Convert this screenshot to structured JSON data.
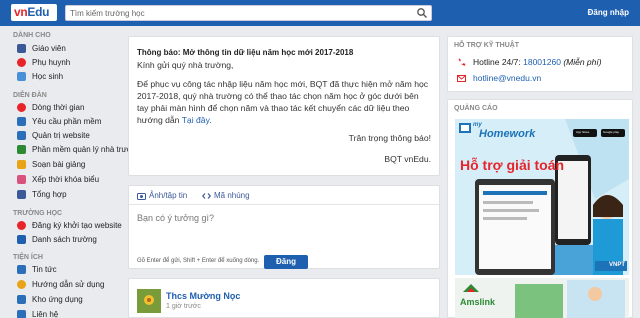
{
  "header": {
    "logo_prefix": "vn",
    "logo_suffix": "Edu",
    "search_placeholder": "Tìm kiếm trường học",
    "login_label": "Đăng nhập"
  },
  "sidebar": {
    "sections": [
      {
        "title": "DÀNH CHO",
        "items": [
          {
            "label": "Giáo viên",
            "icon": "teacher-icon",
            "color": "#3b5998"
          },
          {
            "label": "Phụ huynh",
            "icon": "parent-icon",
            "color": "#e8242b"
          },
          {
            "label": "Học sinh",
            "icon": "student-icon",
            "color": "#4a90d9"
          }
        ]
      },
      {
        "title": "DIỄN ĐÀN",
        "items": [
          {
            "label": "Dòng thời gian",
            "icon": "timeline-icon",
            "color": "#e8242b"
          },
          {
            "label": "Yêu cầu phần mềm",
            "icon": "software-request-icon",
            "color": "#2a6fb8"
          },
          {
            "label": "Quản trị website",
            "icon": "website-admin-icon",
            "color": "#2a6fb8"
          },
          {
            "label": "Phần mềm quản lý nhà trường",
            "icon": "school-software-icon",
            "color": "#2d8a34"
          },
          {
            "label": "Soạn bài giảng",
            "icon": "lesson-icon",
            "color": "#e8a317"
          },
          {
            "label": "Xếp thời khóa biểu",
            "icon": "schedule-icon",
            "color": "#d9527c"
          },
          {
            "label": "Tổng hợp",
            "icon": "summary-icon",
            "color": "#3b5998"
          }
        ]
      },
      {
        "title": "TRƯỜNG HỌC",
        "items": [
          {
            "label": "Đăng ký khởi tạo website",
            "icon": "register-icon",
            "color": "#e8242b"
          },
          {
            "label": "Danh sách trường",
            "icon": "school-list-icon",
            "color": "#1f5fb0"
          }
        ]
      },
      {
        "title": "TIỆN ÍCH",
        "items": [
          {
            "label": "Tin tức",
            "icon": "news-icon",
            "color": "#2a6fb8"
          },
          {
            "label": "Hướng dẫn sử dụng",
            "icon": "guide-icon",
            "color": "#e8a317"
          },
          {
            "label": "Kho ứng dụng",
            "icon": "app-store-icon",
            "color": "#2a6fb8"
          },
          {
            "label": "Liên hệ",
            "icon": "contact-icon",
            "color": "#2a6fb8"
          }
        ]
      }
    ]
  },
  "notice": {
    "title": "Thông báo: Mở thông tin dữ liệu năm học mới 2017-2018",
    "greeting": "Kính gửi quý nhà trường,",
    "body_line1": "Để phục vụ công tác nhập liệu năm học mới, BQT đã thực hiện mở năm học",
    "body_line2": "2017-2018, quý nhà trường có thể thao tác chọn năm học ở góc dưới bên",
    "body_line3": "tay phải màn hình để chọn năm và thao tác kết chuyển các dữ liệu theo",
    "body_line4_prefix": "hướng dẫn",
    "body_link": "Tại đây.",
    "thanks": "Trân trọng thông báo!",
    "signature": "BQT vnEdu."
  },
  "composer": {
    "tab_media": "Ảnh/tập tin",
    "tab_embed": "Mã nhúng",
    "placeholder": "Bạn có ý tưởng gì?",
    "hint": "Gõ Enter để gửi, Shift + Enter để xuống dòng.",
    "post_label": "Đăng"
  },
  "feed": {
    "author": "Thcs Mường Nọc",
    "time": "1 giờ trước"
  },
  "support": {
    "title": "HỖ TRỢ KỸ THUẬT",
    "hotline_label": "Hotline 24/7:",
    "hotline_number": "18001260",
    "hotline_note": "(Miễn phí)",
    "email": "hotline@vnedu.vn"
  },
  "ads": {
    "title": "QUẢNG CÁO",
    "ad1_brand_small": "my",
    "ad1_brand": "Homework",
    "ad1_headline": "Hỗ trợ giải toán",
    "ad1_store1": "App Store",
    "ad1_store2": "Google play",
    "ad1_tag": "VNPT",
    "ad2_brand": "Amslink"
  },
  "colors": {
    "header_bg": "#1f5fb0",
    "link": "#1f5fb0",
    "accent_red": "#e8242b"
  }
}
